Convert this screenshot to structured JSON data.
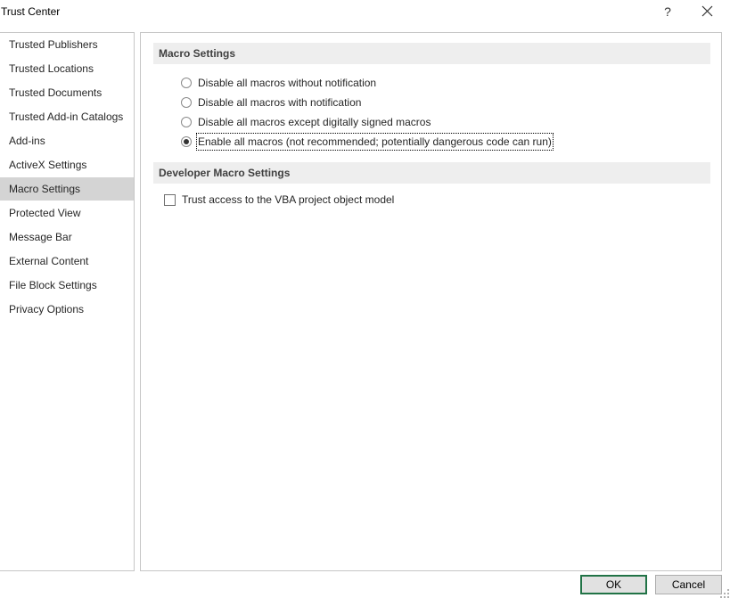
{
  "window": {
    "title": "Trust Center",
    "help_label": "?"
  },
  "nav": {
    "items": [
      {
        "label": "Trusted Publishers"
      },
      {
        "label": "Trusted Locations"
      },
      {
        "label": "Trusted Documents"
      },
      {
        "label": "Trusted Add-in Catalogs"
      },
      {
        "label": "Add-ins"
      },
      {
        "label": "ActiveX Settings"
      },
      {
        "label": "Macro Settings"
      },
      {
        "label": "Protected View"
      },
      {
        "label": "Message Bar"
      },
      {
        "label": "External Content"
      },
      {
        "label": "File Block Settings"
      },
      {
        "label": "Privacy Options"
      }
    ],
    "selected": "Macro Settings"
  },
  "macro_settings": {
    "header": "Macro Settings",
    "options": [
      {
        "label": "Disable all macros without notification",
        "checked": false
      },
      {
        "label": "Disable all macros with notification",
        "checked": false
      },
      {
        "label": "Disable all macros except digitally signed macros",
        "checked": false
      },
      {
        "label": "Enable all macros (not recommended; potentially dangerous code can run)",
        "checked": true
      }
    ]
  },
  "developer_settings": {
    "header": "Developer Macro Settings",
    "vba_access": {
      "label": "Trust access to the VBA project object model",
      "checked": false
    }
  },
  "buttons": {
    "ok": "OK",
    "cancel": "Cancel"
  },
  "colors": {
    "accent": "#217346",
    "nav_selected": "#d4d4d4",
    "section_header_bg": "#eeeeee"
  }
}
